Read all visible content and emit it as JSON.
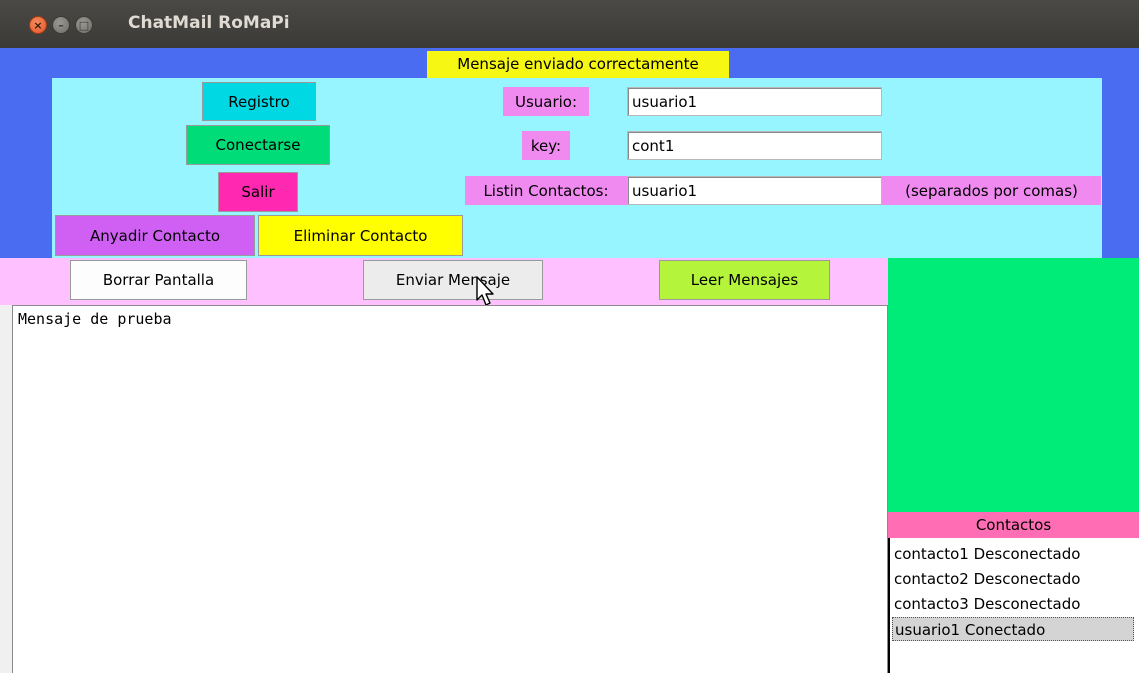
{
  "window": {
    "title": "ChatMail RoMaPi",
    "controls": {
      "close": "×",
      "minimize": "–",
      "maximize": "□"
    }
  },
  "status_message": "Mensaje enviado correctamente",
  "buttons": {
    "registro": "Registro",
    "conectarse": "Conectarse",
    "salir": "Salir",
    "anyadir_contacto": "Anyadir Contacto",
    "eliminar_contacto": "Eliminar Contacto",
    "borrar_pantalla": "Borrar Pantalla",
    "enviar_mensaje": "Enviar Mensaje",
    "leer_mensajes": "Leer Mensajes"
  },
  "form": {
    "usuario_label": "Usuario:",
    "usuario_value": "usuario1",
    "key_label": "key:",
    "key_value": "cont1",
    "listin_label": "Listin Contactos:",
    "listin_value": "usuario1",
    "listin_hint": "(separados por comas)"
  },
  "message_area": {
    "text": "Mensaje de prueba"
  },
  "contacts": {
    "header": "Contactos",
    "items": [
      {
        "label": "contacto1 Desconectado",
        "selected": false
      },
      {
        "label": "contacto2 Desconectado",
        "selected": false
      },
      {
        "label": "contacto3 Desconectado",
        "selected": false
      },
      {
        "label": "usuario1 Conectado",
        "selected": true
      }
    ]
  },
  "colors": {
    "frame_blue": "#4a6cf0",
    "panel_cyan": "#96f5ff",
    "status_yellow": "#f7f714",
    "label_magenta": "#f08af0",
    "button_bar_pink": "#ffc0ff",
    "contacts_green": "#00ec78",
    "contacts_header_pink": "#ff6eb4"
  }
}
